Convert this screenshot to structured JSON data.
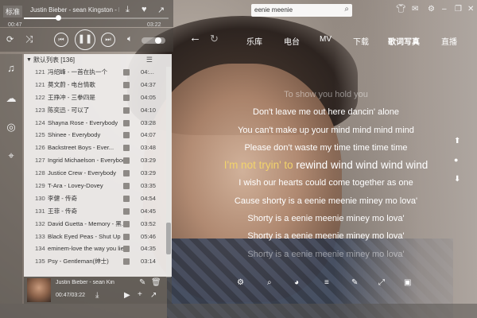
{
  "player": {
    "quality_label": "标准",
    "title": "Justin Bieber - sean Kingston - E",
    "elapsed": "00:47",
    "total": "03:22",
    "progress": 0.235,
    "volume": 0.75
  },
  "search": {
    "value": "eenie meenie"
  },
  "nav": {
    "tabs": [
      {
        "label": "乐库",
        "active": false
      },
      {
        "label": "电台",
        "active": false
      },
      {
        "label": "MV",
        "active": false
      },
      {
        "label": "下载",
        "active": false
      },
      {
        "label": "歌词写真",
        "active": true
      },
      {
        "label": "直播",
        "active": false
      }
    ]
  },
  "playlist": {
    "header": "默认列表 [136]",
    "rows": [
      {
        "num": "121",
        "name": "冯绍峰 - 一首在执一个",
        "duration": "04:..."
      },
      {
        "num": "121",
        "name": "莫文蔚 - 电台情歌",
        "duration": "04:37"
      },
      {
        "num": "122",
        "name": "王挣冲 - 三拳四是",
        "duration": "04:05"
      },
      {
        "num": "123",
        "name": "陈奕迅 - 可以了",
        "duration": "04:10"
      },
      {
        "num": "124",
        "name": "Shayna Rose - Everybody",
        "duration": "03:28"
      },
      {
        "num": "125",
        "name": "Shinee - Everybody",
        "duration": "04:07"
      },
      {
        "num": "126",
        "name": "Backstreet Boys - Ever...",
        "duration": "03:48"
      },
      {
        "num": "127",
        "name": "Ingrid Michaelson - Everybody",
        "duration": "03:29"
      },
      {
        "num": "128",
        "name": "Justice Crew - Everybody",
        "duration": "03:29"
      },
      {
        "num": "129",
        "name": "T-Ara - Lovey-Dovey",
        "duration": "03:35"
      },
      {
        "num": "130",
        "name": "李健 - 传奇",
        "duration": "04:54"
      },
      {
        "num": "131",
        "name": "王菲 - 传奇",
        "duration": "04:45"
      },
      {
        "num": "132",
        "name": "David Guetta - Memory - 黑...",
        "duration": "03:52"
      },
      {
        "num": "133",
        "name": "Black Eyed Peas - Shut Up",
        "duration": "05:46"
      },
      {
        "num": "134",
        "name": "eminem-love the way you lie",
        "duration": "04:35"
      },
      {
        "num": "135",
        "name": "Psy - Gentleman(绅士)",
        "duration": "03:14"
      }
    ]
  },
  "mini": {
    "title": "Justin Bieber - sean Kin",
    "time": "00:47/03:22"
  },
  "lyrics": {
    "lines": [
      {
        "text": "To show you hold you",
        "state": "faded"
      },
      {
        "text": "Don't leave me out here dancin' alone",
        "state": "normal"
      },
      {
        "text": "You can't make up your mind mind mind mind",
        "state": "normal"
      },
      {
        "text": "Please don't waste my time time time time",
        "state": "normal"
      },
      {
        "sung": "I'm not tryin' to ",
        "rest": "rewind wind wind wind wind",
        "state": "current"
      },
      {
        "text": "I wish our hearts could come together as one",
        "state": "normal"
      },
      {
        "text": "Cause shorty is a eenie meenie miney mo lova'",
        "state": "normal"
      },
      {
        "text": "Shorty is a eenie meenie miney mo lova'",
        "state": "normal"
      },
      {
        "text": "Shorty is a eenie meenie miney mo lova'",
        "state": "normal"
      },
      {
        "text": "Shorty is a eenie meenie miney mo lova'",
        "state": "faded"
      }
    ]
  },
  "colors": {
    "accent": "#f2d36b",
    "playlist_bg": "#f3f1ef"
  }
}
